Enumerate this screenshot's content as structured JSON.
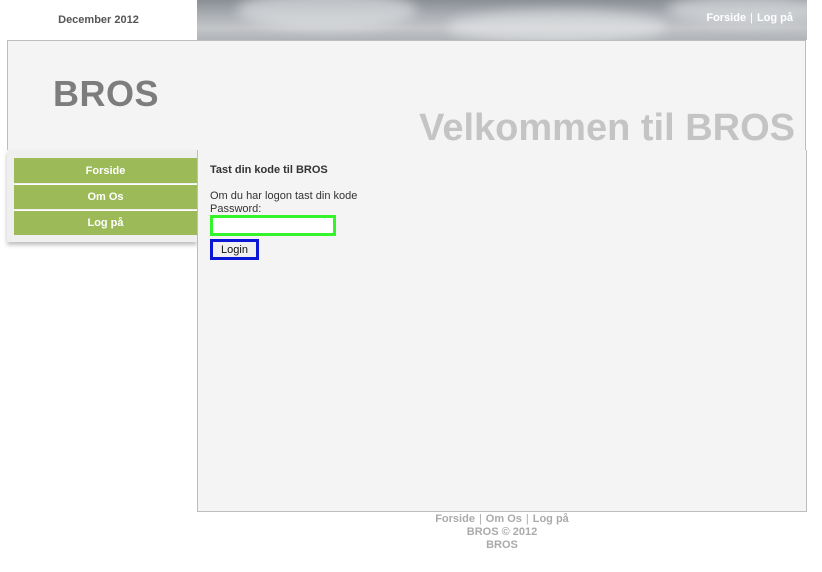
{
  "header": {
    "date": "December 2012",
    "logo": "BROS",
    "welcome": "Velkommen til BROS",
    "top_links": [
      "Forside",
      "Log på"
    ],
    "separator": "|"
  },
  "nav": {
    "items": [
      {
        "label": "Forside"
      },
      {
        "label": "Om Os"
      },
      {
        "label": "Log på"
      }
    ]
  },
  "content": {
    "title": "Tast din kode til BROS",
    "info": "Om du har logon tast din kode",
    "password_label": "Password:",
    "password_value": "",
    "login_label": "Login"
  },
  "footer": {
    "links": [
      "Forside",
      "Om Os",
      "Log på"
    ],
    "separator": "|",
    "copyright": "BROS © 2012",
    "name": "BROS"
  },
  "colors": {
    "nav_green": "#9cbb58",
    "password_highlight": "#34f52b",
    "login_highlight": "#0a17d4",
    "welcome_gray": "#c4c4c4",
    "logo_gray": "#7d7d7d"
  }
}
